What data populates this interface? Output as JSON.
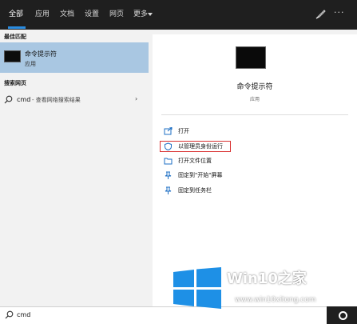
{
  "tabs": [
    {
      "label": "全部",
      "active": true
    },
    {
      "label": "应用",
      "active": false
    },
    {
      "label": "文档",
      "active": false
    },
    {
      "label": "设置",
      "active": false
    },
    {
      "label": "网页",
      "active": false
    },
    {
      "label": "更多",
      "active": false
    }
  ],
  "header_icons": {
    "feedback": "feedback-icon",
    "more": "ellipsis-icon",
    "more_glyph": "···"
  },
  "left": {
    "best_match_heading": "最佳匹配",
    "best_match": {
      "title": "命令提示符",
      "subtitle": "应用"
    },
    "web_heading": "搜索网页",
    "web_result": {
      "query": "cmd",
      "hint": "- 查看网络搜索结果",
      "chevron": "›"
    }
  },
  "right": {
    "app_title": "命令提示符",
    "app_type": "应用",
    "actions": [
      {
        "label": "打开",
        "icon": "open-icon"
      },
      {
        "label": "以管理员身份运行",
        "icon": "run-as-admin-icon",
        "highlighted": true
      },
      {
        "label": "打开文件位置",
        "icon": "folder-icon"
      },
      {
        "label": "固定到\"开始\"屏幕",
        "icon": "pin-icon"
      },
      {
        "label": "固定到任务栏",
        "icon": "pin-taskbar-icon"
      }
    ]
  },
  "search": {
    "value": "cmd",
    "icon": "search-icon"
  },
  "watermark": {
    "text": "Win10之家",
    "url": "www.win10xitong.com"
  },
  "colors": {
    "accent": "#2a8ce0",
    "highlight_row": "#a9c7e2",
    "topbar": "#1f1f1f",
    "red_box": "#d93333",
    "windows_logo": "#1e90e6"
  }
}
